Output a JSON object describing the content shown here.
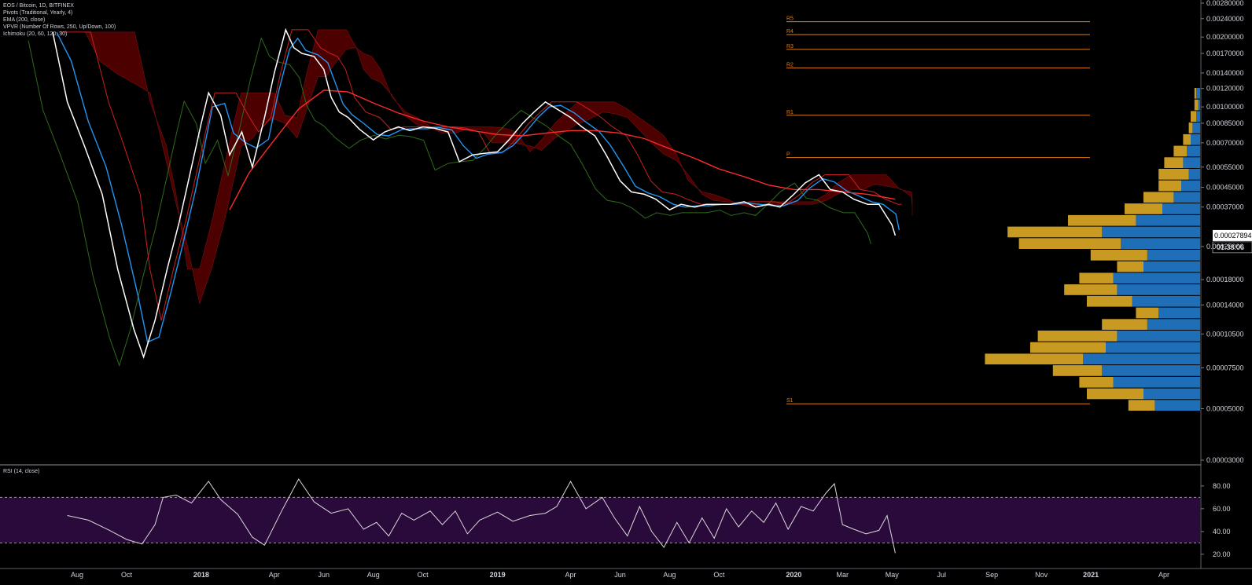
{
  "legend": {
    "symbol": "EOS / Bitcoin, 1D, BITFINEX",
    "pivots": "Pivots (Traditional, Yearly, 4)",
    "ema": "EMA (200, close)",
    "vpvr": "VPVR (Number Of Rows, 250, Up/Down, 100)",
    "ichimoku": "Ichimoku (20, 60, 120, 30)"
  },
  "rsi_legend": "RSI (14, close)",
  "last_price_label": "0.00027894",
  "countdown_label": "01:38:06",
  "colors": {
    "background": "#000000",
    "price": "#ffffff",
    "ema": "#ff2a2a",
    "kijun": "#2196f3",
    "conversion": "#cc1f1f",
    "lagging": "#2f6b1a",
    "cloud_bear": "#5a0000",
    "cloud_bull": "#0d3a0d",
    "pivot": "#e07b12",
    "vp_up": "#1e6fb8",
    "vp_down": "#c89a22",
    "rsi_band": "#2a0a3a",
    "rsi_line": "#d9d9d9"
  },
  "chart_data": [
    {
      "type": "line",
      "title": "EOS / Bitcoin, 1D, BITFINEX",
      "y_axis_ticks": [
        "0.00280000",
        "0.00240000",
        "0.00200000",
        "0.00170000",
        "0.00140000",
        "0.00120000",
        "0.00100000",
        "0.00085000",
        "0.00070000",
        "0.00055000",
        "0.00045000",
        "0.00037000",
        "0.00025000",
        "0.00018000",
        "0.00014000",
        "0.00010500",
        "0.00007500",
        "0.00005000",
        "0.00003000"
      ],
      "x_axis_ticks": [
        "Aug",
        "Oct",
        "2018",
        "Apr",
        "Jun",
        "Aug",
        "Oct",
        "2019",
        "Apr",
        "Jun",
        "Aug",
        "Oct",
        "2020",
        "Mar",
        "May",
        "Jul",
        "Sep",
        "Nov",
        "2021",
        "Apr"
      ],
      "y_scale": "log",
      "ylim": [
        3e-05,
        0.0028
      ],
      "series": [
        {
          "name": "EOS / Bitcoin",
          "x": [
            "2017-07-02",
            "2017-07-20",
            "2017-08-10",
            "2017-09-01",
            "2017-09-20",
            "2017-10-10",
            "2017-10-22",
            "2017-11-05",
            "2017-11-20",
            "2017-12-05",
            "2017-12-20",
            "2018-01-01",
            "2018-01-10",
            "2018-01-25",
            "2018-02-05",
            "2018-02-20",
            "2018-03-05",
            "2018-03-20",
            "2018-04-01",
            "2018-04-15",
            "2018-04-25",
            "2018-05-05",
            "2018-05-20",
            "2018-06-01",
            "2018-06-10",
            "2018-06-20",
            "2018-07-01",
            "2018-07-15",
            "2018-08-01",
            "2018-08-15",
            "2018-09-01",
            "2018-09-15",
            "2018-10-01",
            "2018-10-15",
            "2018-11-01",
            "2018-11-15",
            "2018-12-01",
            "2018-12-15",
            "2019-01-01",
            "2019-01-15",
            "2019-02-01",
            "2019-02-15",
            "2019-03-01",
            "2019-03-15",
            "2019-04-01",
            "2019-04-15",
            "2019-05-01",
            "2019-05-15",
            "2019-06-01",
            "2019-06-15",
            "2019-07-01",
            "2019-07-15",
            "2019-08-01",
            "2019-08-15",
            "2019-09-01",
            "2019-09-15",
            "2019-10-01",
            "2019-10-15",
            "2019-11-01",
            "2019-11-15",
            "2019-12-01",
            "2019-12-15",
            "2020-01-01",
            "2020-01-15",
            "2020-02-01",
            "2020-02-15",
            "2020-03-01",
            "2020-03-15",
            "2020-04-01",
            "2020-04-15",
            "2020-05-01",
            "2020-05-05"
          ],
          "values": [
            0.0021,
            0.00105,
            0.00068,
            0.00042,
            0.0002,
            0.00011,
            8.35e-05,
            0.00012,
            0.0002,
            0.00032,
            0.00055,
            0.00085,
            0.00115,
            0.00092,
            0.00062,
            0.00078,
            0.00055,
            0.0009,
            0.0014,
            0.00215,
            0.0018,
            0.0017,
            0.00165,
            0.00145,
            0.0011,
            0.00095,
            0.0009,
            0.0008,
            0.00072,
            0.00078,
            0.00082,
            0.00079,
            0.00082,
            0.00081,
            0.00078,
            0.00058,
            0.00062,
            0.00063,
            0.00064,
            0.00072,
            0.00085,
            0.00095,
            0.00105,
            0.00098,
            0.0009,
            0.00082,
            0.00075,
            0.00062,
            0.00048,
            0.00043,
            0.00042,
            0.0004,
            0.00036,
            0.00038,
            0.00037,
            0.00038,
            0.00038,
            0.00038,
            0.00039,
            0.00037,
            0.00038,
            0.00037,
            0.00042,
            0.00047,
            0.00051,
            0.00044,
            0.00043,
            0.0004,
            0.00038,
            0.00038,
            0.00031,
            0.00027894
          ]
        },
        {
          "name": "EMA (200, close)",
          "x": [
            "2018-02-05",
            "2018-03-01",
            "2018-04-01",
            "2018-05-01",
            "2018-06-01",
            "2018-07-01",
            "2018-08-01",
            "2018-09-01",
            "2018-10-01",
            "2018-11-01",
            "2018-12-01",
            "2019-01-01",
            "2019-02-01",
            "2019-03-01",
            "2019-04-01",
            "2019-05-01",
            "2019-06-01",
            "2019-07-01",
            "2019-08-01",
            "2019-09-01",
            "2019-10-01",
            "2019-11-01",
            "2019-12-01",
            "2020-01-01",
            "2020-02-01",
            "2020-03-01",
            "2020-04-01",
            "2020-05-05"
          ],
          "values": [
            0.00036,
            0.00052,
            0.00072,
            0.00098,
            0.00118,
            0.00116,
            0.00104,
            0.00094,
            0.00087,
            0.00082,
            0.00079,
            0.00076,
            0.00075,
            0.00077,
            0.00079,
            0.00079,
            0.00077,
            0.00073,
            0.00066,
            0.0006,
            0.00054,
            0.0005,
            0.00046,
            0.00044,
            0.00044,
            0.00043,
            0.00042,
            0.0004
          ]
        }
      ],
      "pivots": [
        {
          "label": "R5",
          "value": 0.00233
        },
        {
          "label": "R4",
          "value": 0.00205
        },
        {
          "label": "R3",
          "value": 0.00177
        },
        {
          "label": "R2",
          "value": 0.00147
        },
        {
          "label": "R1",
          "value": 0.00092
        },
        {
          "label": "P",
          "value": 0.000605
        },
        {
          "label": "S1",
          "value": 5.25e-05
        }
      ]
    },
    {
      "type": "line",
      "title": "RSI (14, close)",
      "y_axis_ticks": [
        "80.00",
        "60.00",
        "40.00",
        "20.00"
      ],
      "ylim": [
        13,
        93
      ],
      "bands": [
        70,
        30
      ],
      "x": [
        "2017-07-20",
        "2017-08-15",
        "2017-09-10",
        "2017-10-01",
        "2017-10-20",
        "2017-11-05",
        "2017-11-15",
        "2017-12-01",
        "2017-12-20",
        "2018-01-10",
        "2018-01-25",
        "2018-02-15",
        "2018-03-05",
        "2018-03-20",
        "2018-04-10",
        "2018-05-01",
        "2018-05-20",
        "2018-06-10",
        "2018-07-01",
        "2018-07-20",
        "2018-08-05",
        "2018-08-20",
        "2018-09-05",
        "2018-09-20",
        "2018-10-10",
        "2018-10-25",
        "2018-11-10",
        "2018-11-25",
        "2018-12-10",
        "2019-01-01",
        "2019-01-20",
        "2019-02-10",
        "2019-03-01",
        "2019-03-15",
        "2019-04-01",
        "2019-04-20",
        "2019-05-10",
        "2019-05-25",
        "2019-06-10",
        "2019-06-25",
        "2019-07-10",
        "2019-07-25",
        "2019-08-10",
        "2019-08-25",
        "2019-09-10",
        "2019-09-25",
        "2019-10-10",
        "2019-10-25",
        "2019-11-10",
        "2019-11-25",
        "2019-12-10",
        "2019-12-25",
        "2020-01-10",
        "2020-01-25",
        "2020-02-10",
        "2020-02-20",
        "2020-03-01",
        "2020-03-15",
        "2020-03-30",
        "2020-04-15",
        "2020-04-25",
        "2020-05-05"
      ],
      "values": [
        54,
        50,
        41,
        33,
        29,
        46,
        70,
        72,
        65,
        84,
        68,
        55,
        35,
        28,
        58,
        86,
        66,
        56,
        60,
        42,
        48,
        36,
        56,
        50,
        58,
        46,
        58,
        38,
        50,
        57,
        49,
        54,
        56,
        62,
        84,
        60,
        70,
        52,
        36,
        62,
        40,
        26,
        48,
        30,
        52,
        34,
        60,
        44,
        58,
        48,
        65,
        42,
        62,
        58,
        74,
        82,
        46,
        42,
        38,
        41,
        54,
        21
      ]
    },
    {
      "type": "bar",
      "title": "VPVR (Number Of Rows, 250, Up/Down, 100)",
      "series": [
        {
          "name": "Up",
          "values": [
            0.02,
            0.01,
            0.02,
            0.04,
            0.05,
            0.07,
            0.09,
            0.06,
            0.1,
            0.14,
            0.2,
            0.34,
            0.52,
            0.42,
            0.28,
            0.3,
            0.46,
            0.44,
            0.36,
            0.22,
            0.28,
            0.44,
            0.5,
            0.62,
            0.52,
            0.46,
            0.3,
            0.24
          ]
        },
        {
          "name": "Down",
          "values": [
            0.01,
            0.02,
            0.03,
            0.02,
            0.04,
            0.07,
            0.1,
            0.16,
            0.12,
            0.16,
            0.2,
            0.36,
            0.5,
            0.54,
            0.3,
            0.14,
            0.18,
            0.28,
            0.24,
            0.12,
            0.24,
            0.42,
            0.4,
            0.52,
            0.26,
            0.18,
            0.3,
            0.14
          ]
        }
      ]
    }
  ]
}
